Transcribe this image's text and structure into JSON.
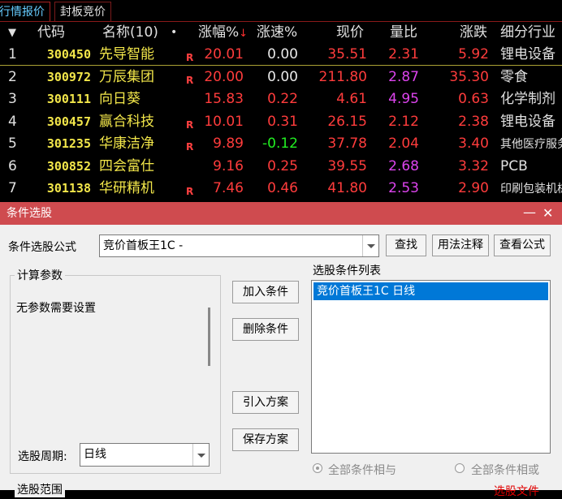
{
  "tabs": [
    {
      "label": "行情报价",
      "active": true
    },
    {
      "label": "封板竞价",
      "active": false
    }
  ],
  "quote_table": {
    "sort_indicator": "▼",
    "columns": {
      "code": "代码",
      "name": "名称(10)",
      "dot": "•",
      "change_pct": "涨幅%",
      "speed_pct": "涨速%",
      "price": "现价",
      "volume_ratio": "量比",
      "change": "涨跌",
      "industry": "细分行业"
    },
    "rows": [
      {
        "num": "1",
        "code": "300450",
        "name": "先导智能",
        "flag": "R",
        "change_pct": "20.01",
        "speed_pct": "0.00",
        "price": "35.51",
        "volume_ratio": "2.31",
        "change": "5.92",
        "industry": "锂电设备"
      },
      {
        "num": "2",
        "code": "300972",
        "name": "万辰集团",
        "flag": "R",
        "change_pct": "20.00",
        "speed_pct": "0.00",
        "price": "211.80",
        "volume_ratio": "2.87",
        "change": "35.30",
        "industry": "零食"
      },
      {
        "num": "3",
        "code": "300111",
        "name": "向日葵",
        "flag": "",
        "change_pct": "15.83",
        "speed_pct": "0.22",
        "price": "4.61",
        "volume_ratio": "4.95",
        "change": "0.63",
        "industry": "化学制剂"
      },
      {
        "num": "4",
        "code": "300457",
        "name": "赢合科技",
        "flag": "R",
        "change_pct": "10.01",
        "speed_pct": "0.31",
        "price": "26.15",
        "volume_ratio": "2.12",
        "change": "2.38",
        "industry": "锂电设备"
      },
      {
        "num": "5",
        "code": "301235",
        "name": "华康洁净",
        "flag": "R",
        "change_pct": "9.89",
        "speed_pct": "-0.12",
        "price": "37.78",
        "volume_ratio": "2.04",
        "change": "3.40",
        "industry": "其他医疗服务"
      },
      {
        "num": "6",
        "code": "300852",
        "name": "四会富仕",
        "flag": "",
        "change_pct": "9.16",
        "speed_pct": "0.25",
        "price": "39.55",
        "volume_ratio": "2.68",
        "change": "3.32",
        "industry": "PCB"
      },
      {
        "num": "7",
        "code": "301138",
        "name": "华研精机",
        "flag": "R",
        "change_pct": "7.46",
        "speed_pct": "0.46",
        "price": "41.80",
        "volume_ratio": "2.53",
        "change": "2.90",
        "industry": "印刷包装机械"
      }
    ],
    "colors": {
      "code": "#f2e64a",
      "up": "#ff3c3c",
      "down": "#22ee22",
      "flat": "#e8e8e8",
      "volume_ratio_high": "#dd44ee"
    }
  },
  "dialog": {
    "title": "条件选股",
    "minimize_glyph": "—",
    "close_glyph": "✕",
    "formula_label": "条件选股公式",
    "formula_value": "竞价首板王1C  -",
    "buttons": {
      "find": "查找",
      "usage": "用法注释",
      "view": "查看公式",
      "add": "加入条件",
      "delete": "删除条件",
      "import": "引入方案",
      "save": "保存方案"
    },
    "params_group_title": "计算参数",
    "params_text": "无参数需要设置",
    "period_label": "选股周期:",
    "period_value": "日线",
    "condition_list_label": "选股条件列表",
    "condition_items": [
      "竞价首板王1C  日线"
    ],
    "radio_and": "全部条件相与",
    "radio_or": "全部条件相或",
    "range_group_title": "选股范围",
    "bottom_right_text": "选股文件"
  }
}
